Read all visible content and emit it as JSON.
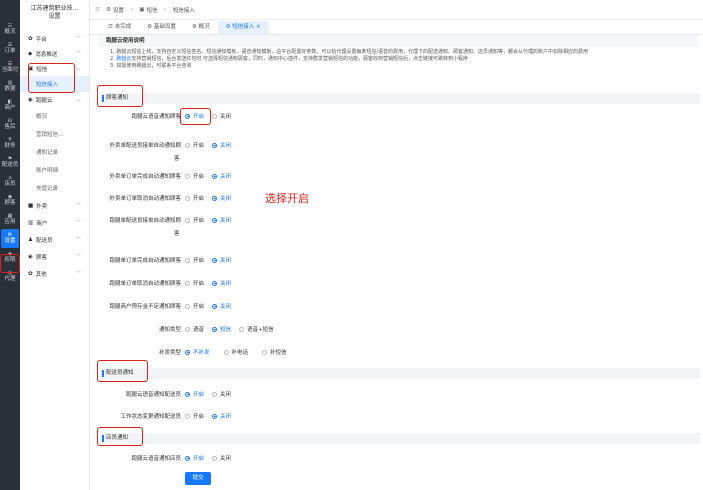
{
  "rail": [
    {
      "icon": "☷",
      "label": "概况"
    },
    {
      "icon": "☰",
      "label": "订单"
    },
    {
      "icon": "☰",
      "label": "当面付"
    },
    {
      "icon": "▥",
      "label": "数据"
    },
    {
      "icon": "◧",
      "label": "商户"
    },
    {
      "icon": "☊",
      "label": "售后"
    },
    {
      "icon": "¥",
      "label": "财务"
    },
    {
      "icon": "⚑",
      "label": "配送员"
    },
    {
      "icon": "⌂",
      "label": "店员"
    },
    {
      "icon": "◉",
      "label": "顾客"
    },
    {
      "icon": "▦",
      "label": "应用"
    },
    {
      "icon": "⚙",
      "label": "设置"
    },
    {
      "icon": "◈",
      "label": "权限"
    },
    {
      "icon": "◎",
      "label": "代理"
    }
  ],
  "sidebar": {
    "school": "江苏建筑职业技...",
    "school_sub": "设置",
    "groups": [
      {
        "icon": "✿",
        "label": "平台"
      },
      {
        "icon": "◆",
        "label": "消息推送"
      },
      {
        "icon": "▣",
        "label": "短信"
      },
      {
        "icon": "◉",
        "label": "跑腿云"
      },
      {
        "icon": "■",
        "label": "外卖"
      },
      {
        "icon": "▥",
        "label": "商户"
      },
      {
        "icon": "♟",
        "label": "配送员"
      },
      {
        "icon": "◉",
        "label": "顾客"
      },
      {
        "icon": "✿",
        "label": "其他"
      }
    ],
    "sms_sub": "短信接入",
    "cloud_subs": [
      "概况",
      "营销短信...",
      "通知记录",
      "账户明细",
      "充值记录"
    ]
  },
  "breadcrumb": {
    "a": "设置",
    "b": "短信",
    "c": "短信接入"
  },
  "tabs": [
    {
      "label": "未完成"
    },
    {
      "label": "基础设置"
    },
    {
      "label": "概况"
    },
    {
      "label": "短信接入"
    }
  ],
  "usage": {
    "title": "跑腿云使用说明",
    "line1": "1. 跑腿云短信上线，支持自定义短信签名、短信通知模板、语音通知模板、总平台配置好参数，可以给代理设置每条短信/语音的费用，代理下的配送通知、顾客通知、店员通知等，都会从代理的账户中扣除相应的费用",
    "line2_pre": "2. ",
    "line2_link": "跑腿云",
    "line2_post": "支持营销短信，后台发送红包时,可选择短信通知顾客，同时，通知中心插件，支持群发营销短信的功能，顾客收到营销短信后，点击链接可跳转到小程序",
    "line3": "3. 如需使用跑腿云，可联系平台咨询"
  },
  "sections": {
    "customer": "顾客通知",
    "courier": "配送员通知",
    "staff": "店员通知"
  },
  "options": {
    "on": "开启",
    "off": "关闭"
  },
  "customer_rows": [
    {
      "label": "跑腿云语音通知顾客",
      "on": true
    },
    {
      "label": "外卖单配送员接单自动通知顾",
      "label2": "客",
      "on": false
    },
    {
      "label": "外卖单订单完成自动通知顾客",
      "on": false
    },
    {
      "label": "外卖单订单取消自动通知顾客",
      "on": false
    },
    {
      "label": "跑腿单配送员接单自动通知顾",
      "label2": "客",
      "on": false
    },
    {
      "label": "跑腿单订单完成自动通知顾客",
      "on": false
    },
    {
      "label": "跑腿单订单取消自动通知顾客",
      "on": false
    },
    {
      "label": "跑腿商户预存金不足通知顾客",
      "on": false
    }
  ],
  "notify_type": {
    "label": "通知类型",
    "opts": [
      "语音",
      "短信",
      "语音+短信"
    ],
    "selected": 1
  },
  "resend_type": {
    "label": "补发类型",
    "opts": [
      "不补发",
      "补电话",
      "补短信"
    ],
    "selected": 0
  },
  "courier_rows": [
    {
      "label": "跑腿云语音通知配送员",
      "on": true
    },
    {
      "label": "工作状态变更通知配送员",
      "on": false
    }
  ],
  "staff_rows": [
    {
      "label": "跑腿云语音通知店员",
      "on": true
    }
  ],
  "annotation": "选择开启",
  "submit": "提交",
  "colors": {
    "accent": "#1677ff",
    "highlight": "#e0201b",
    "rail": "#2b2f3a"
  }
}
